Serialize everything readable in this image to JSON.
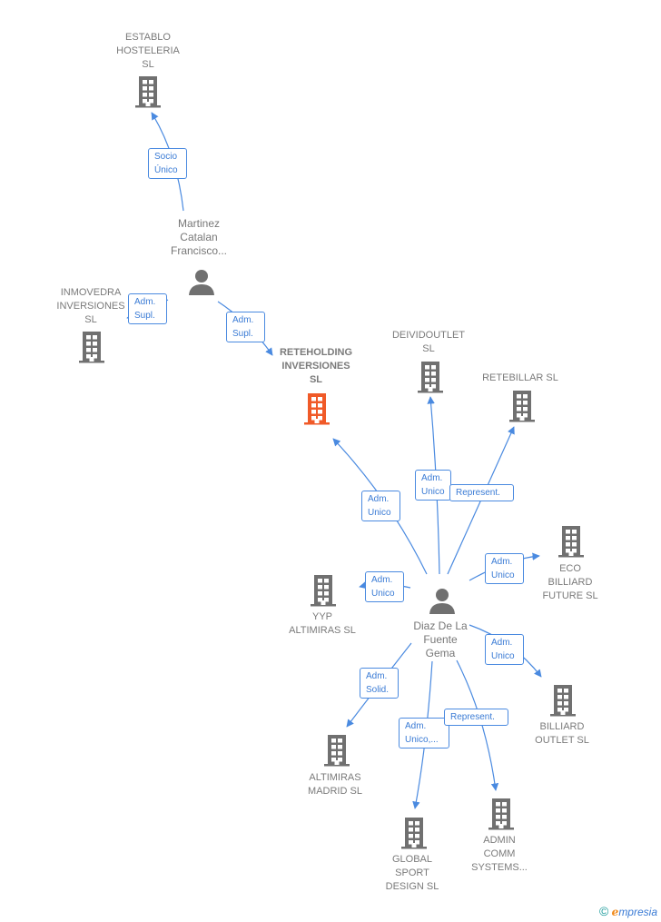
{
  "colors": {
    "edge": "#4a8ae0",
    "company": "#707070",
    "main_company": "#f05a28",
    "person": "#707070"
  },
  "nodes": [
    {
      "id": "establo",
      "type": "company",
      "label": [
        "ESTABLO",
        "HOSTELERIA",
        "SL"
      ]
    },
    {
      "id": "martinez",
      "type": "person",
      "label": [
        "Martinez",
        "Catalan",
        "Francisco..."
      ]
    },
    {
      "id": "inmovedra",
      "type": "company",
      "label": [
        "INMOVEDRA",
        "INVERSIONES",
        "SL"
      ]
    },
    {
      "id": "reteholding",
      "type": "main",
      "label": [
        "RETEHOLDING",
        "INVERSIONES",
        "SL"
      ]
    },
    {
      "id": "deividoutlet",
      "type": "company",
      "label": [
        "DEIVIDOUTLET",
        "SL"
      ]
    },
    {
      "id": "retebillar",
      "type": "company",
      "label": [
        "RETEBILLAR SL"
      ]
    },
    {
      "id": "eco",
      "type": "company",
      "label": [
        "ECO",
        "BILLIARD",
        "FUTURE  SL"
      ]
    },
    {
      "id": "yyp",
      "type": "company",
      "label": [
        "YYP",
        "ALTIMIRAS  SL"
      ]
    },
    {
      "id": "diaz",
      "type": "person",
      "label": [
        "Diaz De La",
        "Fuente",
        "Gema"
      ]
    },
    {
      "id": "billiard_outlet",
      "type": "company",
      "label": [
        "BILLIARD",
        "OUTLET  SL"
      ]
    },
    {
      "id": "altimiras_madrid",
      "type": "company",
      "label": [
        "ALTIMIRAS",
        "MADRID SL"
      ]
    },
    {
      "id": "global_sport",
      "type": "company",
      "label": [
        "GLOBAL",
        "SPORT",
        "DESIGN SL"
      ]
    },
    {
      "id": "admin_comm",
      "type": "company",
      "label": [
        "ADMIN",
        "COMM",
        "SYSTEMS..."
      ]
    }
  ],
  "edges": [
    {
      "from": "martinez",
      "to": "establo",
      "label": [
        "Socio",
        "Único"
      ]
    },
    {
      "from": "martinez",
      "to": "inmovedra",
      "label": [
        "Adm.",
        "Supl."
      ]
    },
    {
      "from": "martinez",
      "to": "reteholding",
      "label": [
        "Adm.",
        "Supl."
      ]
    },
    {
      "from": "diaz",
      "to": "reteholding",
      "label": [
        "Adm.",
        "Unico"
      ]
    },
    {
      "from": "diaz",
      "to": "deividoutlet",
      "label": [
        "Adm.",
        "Unico"
      ]
    },
    {
      "from": "diaz",
      "to": "retebillar",
      "label": [
        "Represent."
      ]
    },
    {
      "from": "diaz",
      "to": "eco",
      "label": [
        "Adm.",
        "Unico"
      ]
    },
    {
      "from": "diaz",
      "to": "yyp",
      "label": [
        "Adm.",
        "Unico"
      ]
    },
    {
      "from": "diaz",
      "to": "billiard_outlet",
      "label": [
        "Adm.",
        "Unico"
      ]
    },
    {
      "from": "diaz",
      "to": "altimiras_madrid",
      "label": [
        "Adm.",
        "Solid."
      ]
    },
    {
      "from": "diaz",
      "to": "global_sport",
      "label": [
        "Adm.",
        "Unico,..."
      ]
    },
    {
      "from": "diaz",
      "to": "admin_comm",
      "label": [
        "Represent."
      ]
    }
  ],
  "footer": {
    "copyright": "©",
    "brand_first": "e",
    "brand_rest": "mpresia"
  }
}
